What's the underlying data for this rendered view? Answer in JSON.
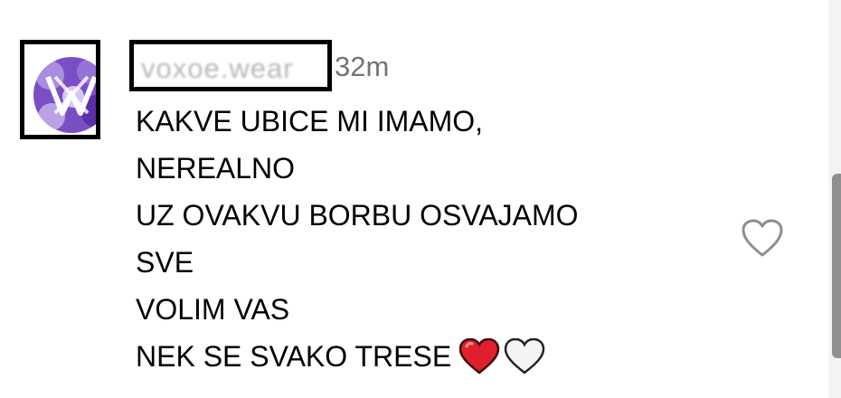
{
  "comment": {
    "username": "voxoe.wear",
    "timestamp": "32m",
    "lines": [
      "KAKVE UBICE MI IMAMO,",
      "NEREALNO",
      "UZ OVAKVU BORBU OSVAJAMO",
      "SVE",
      "VOLIM VAS",
      "NEK SE SVAKO TRESE"
    ],
    "emojis": [
      "red-heart-icon",
      "white-heart-icon"
    ]
  },
  "icons": {
    "avatar": "purple-logo-avatar",
    "like": "heart-outline-icon"
  },
  "colors": {
    "text": "#000000",
    "timestamp": "#737373",
    "heart_red": "#e0202e",
    "heart_outline": "#8e8e8e",
    "avatar_purple": "#6a3fb5"
  }
}
